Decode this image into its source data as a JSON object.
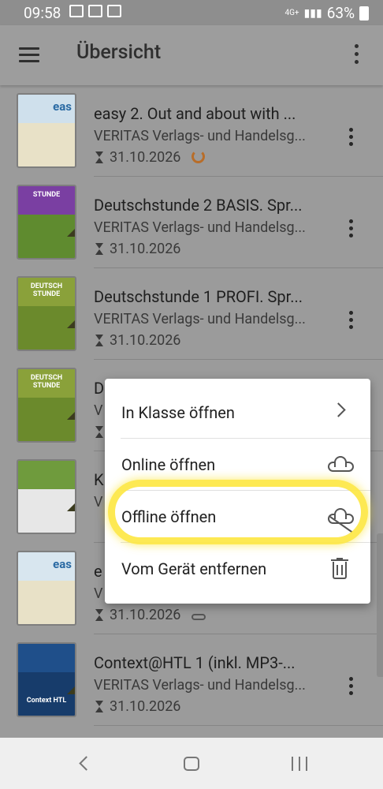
{
  "status_bar": {
    "time": "09:58",
    "network": "4G+",
    "battery": "63%"
  },
  "app_bar": {
    "title": "Übersicht"
  },
  "books": [
    {
      "title": "easy 2. Out and about with ...",
      "publisher": "VERITAS Verlags- und Handelsg...",
      "date": "31.10.2026",
      "status": "downloading",
      "cover_colors": {
        "top": "#cfe0ec",
        "bottom": "#e8e1c7"
      },
      "cover_word": "eas"
    },
    {
      "title": "Deutschstunde 2 BASIS. Spr...",
      "publisher": "VERITAS Verlags- und Handelsg...",
      "date": "31.10.2026",
      "status": "none",
      "cover_colors": {
        "top": "#7a3fa2",
        "bottom": "#5f8b2f"
      },
      "cover_word": "STUNDE"
    },
    {
      "title": "Deutschstunde 1 PROFI. Spr...",
      "publisher": "VERITAS Verlags- und Handelsg...",
      "date": "31.10.2026",
      "status": "none",
      "cover_colors": {
        "top": "#8aa13a",
        "bottom": "#6b8a2c"
      },
      "cover_word": "DEUTSCH STUNDE"
    },
    {
      "title": "D",
      "publisher": "V",
      "date": "",
      "status": "none",
      "cover_colors": {
        "top": "#8aa13a",
        "bottom": "#6b8a2c"
      },
      "cover_word": "DEUTSCH STUNDE"
    },
    {
      "title": "K",
      "publisher": "V",
      "date": "",
      "status": "none",
      "cover_colors": {
        "top": "#6f9b3d",
        "bottom": "#e7e7e7"
      },
      "cover_word": ""
    },
    {
      "title": "e",
      "publisher": "V",
      "date": "31.10.2026",
      "status": "cloud",
      "cover_colors": {
        "top": "#d8e6ef",
        "bottom": "#e8e1c7"
      },
      "cover_word": "eas"
    },
    {
      "title": "Context@HTL 1 (inkl. MP3-...",
      "publisher": "VERITAS Verlags- und Handelsg...",
      "date": "31.10.2026",
      "status": "none",
      "cover_colors": {
        "top": "#1f4f8a",
        "bottom": "#173c6b"
      },
      "cover_word": "Context HTL"
    }
  ],
  "context_menu": {
    "items": [
      {
        "label": "In Klasse öffnen",
        "icon": "chevron-right-icon"
      },
      {
        "label": "Online öffnen",
        "icon": "cloud-icon"
      },
      {
        "label": "Offline öffnen",
        "icon": "cloud-off-icon"
      },
      {
        "label": "Vom Gerät entfernen",
        "icon": "trash-icon"
      }
    ]
  },
  "colors": {
    "highlight": "#fde740",
    "progress": "#b86d29"
  }
}
